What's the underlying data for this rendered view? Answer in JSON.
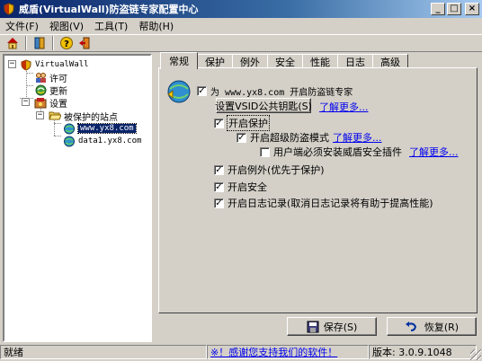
{
  "window": {
    "title": "威盾(VirtualWall)防盗链专家配置中心"
  },
  "menu": [
    "文件(F)",
    "视图(V)",
    "工具(T)",
    "帮助(H)"
  ],
  "tree": {
    "root": "VirtualWall",
    "license": "许可",
    "update": "更新",
    "settings": "设置",
    "protected_sites": "被保护的站点",
    "site_selected": "www.yx8.com",
    "site_2": "data1.yx8.com"
  },
  "tabs": [
    "常规",
    "保护",
    "例外",
    "安全",
    "性能",
    "日志",
    "高级"
  ],
  "general": {
    "protect_site_text": "为 www.yx8.com 开启防盗链专家",
    "set_vsid_key_button": "设置VSID公共钥匙(S)",
    "learn_more": "了解更多...",
    "enable_protection": "开启保护",
    "super_mode": "开启超级防盗模式",
    "require_plugin": "用户端必须安装威盾安全插件",
    "enable_exceptions": "开启例外(优先于保护)",
    "enable_security": "开启安全",
    "enable_logging": "开启日志记录(取消日志记录将有助于提高性能)"
  },
  "buttons": {
    "save": "保存(S)",
    "restore": "恢复(R)"
  },
  "status": {
    "ready": "就绪",
    "thanks": "※！感谢您支持我们的软件！",
    "version": "版本: 3.0.9.1048"
  }
}
